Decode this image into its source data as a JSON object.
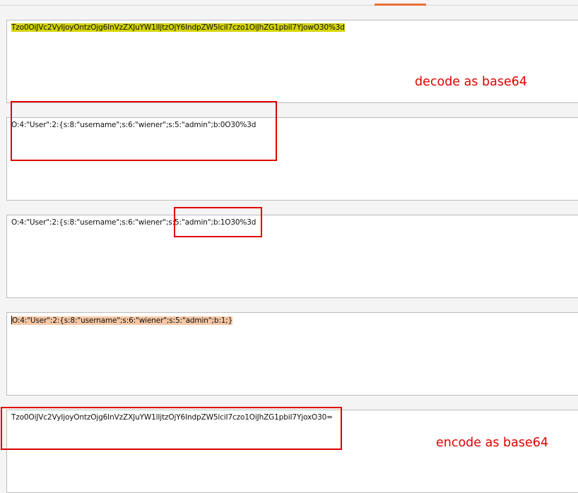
{
  "panes": [
    {
      "text": "Tzo0OiJVc2VyIjoyOntzOjg6InVzZXJuYW1lIjtzOjY6IndpZW5lciI7czo1OiJhZG1pbiI7YjowO30%3d",
      "highlight": "selected"
    },
    {
      "text": "O:4:\"User\":2:{s:8:\"username\";s:6:\"wiener\";s:5:\"admin\";b:0O30%3d",
      "highlight": "none"
    },
    {
      "text": "O:4:\"User\":2:{s:8:\"username\";s:6:\"wiener\";s:5:\"admin\";b:1O30%3d",
      "highlight": "none"
    },
    {
      "text": "O:4:\"User\":2:{s:8:\"username\";s:6:\"wiener\";s:5:\"admin\";b:1;}",
      "highlight": "selected-orange"
    },
    {
      "text": "Tzo0OiJVc2VyIjoyOntzOjg6InVzZXJuYW1lIjtzOjY6IndpZW5lciI7czo1OiJhZG1pbiI7YjoxO30=",
      "highlight": "none"
    }
  ],
  "annotations": {
    "decode": "decode as base64",
    "encode": "encode as base64"
  },
  "colors": {
    "annotation": "#e00000",
    "tab_accent": "#e8703a",
    "selection_yellow": "#d4d400",
    "selection_orange": "#f5c7a4"
  }
}
